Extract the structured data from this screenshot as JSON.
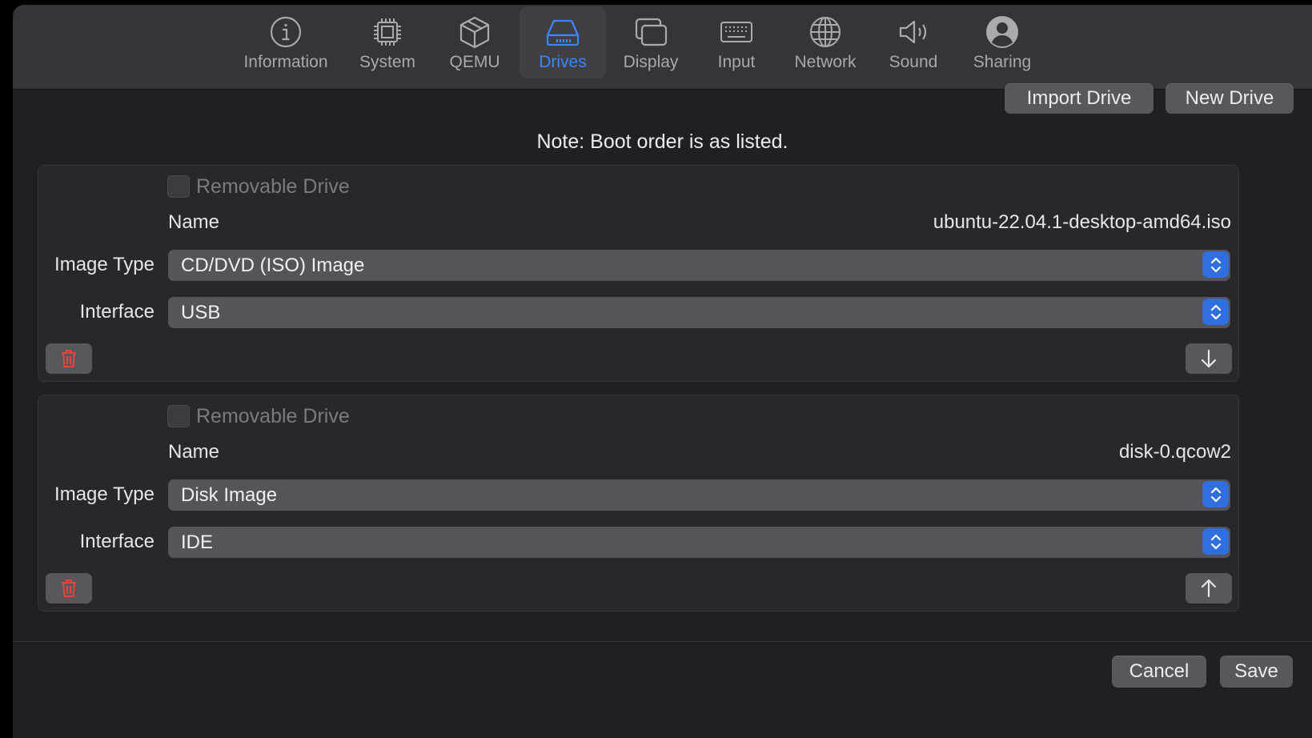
{
  "toolbar": {
    "tabs": [
      {
        "label": "Information",
        "icon": "info-icon"
      },
      {
        "label": "System",
        "icon": "cpu-chip-icon"
      },
      {
        "label": "QEMU",
        "icon": "cube-icon"
      },
      {
        "label": "Drives",
        "icon": "drive-icon"
      },
      {
        "label": "Display",
        "icon": "display-icon"
      },
      {
        "label": "Input",
        "icon": "keyboard-icon"
      },
      {
        "label": "Network",
        "icon": "globe-icon"
      },
      {
        "label": "Sound",
        "icon": "speaker-icon"
      },
      {
        "label": "Sharing",
        "icon": "person-icon"
      }
    ],
    "active_tab": "Drives",
    "accent_color": "#3a86ff"
  },
  "actions": {
    "import_drive": "Import Drive",
    "new_drive": "New Drive"
  },
  "note": "Note: Boot order is as listed.",
  "labels": {
    "removable": "Removable Drive",
    "name": "Name",
    "image_type": "Image Type",
    "interface": "Interface"
  },
  "drives": [
    {
      "removable_checked": false,
      "name": "ubuntu-22.04.1-desktop-amd64.iso",
      "image_type": "CD/DVD (ISO) Image",
      "interface": "USB",
      "move_icon": "arrow-down-icon"
    },
    {
      "removable_checked": false,
      "name": "disk-0.qcow2",
      "image_type": "Disk Image",
      "interface": "IDE",
      "move_icon": "arrow-up-icon"
    }
  ],
  "footer": {
    "cancel": "Cancel",
    "save": "Save"
  },
  "colors": {
    "delete_icon": "#e0483e",
    "stepper": "#2f6fe0"
  }
}
